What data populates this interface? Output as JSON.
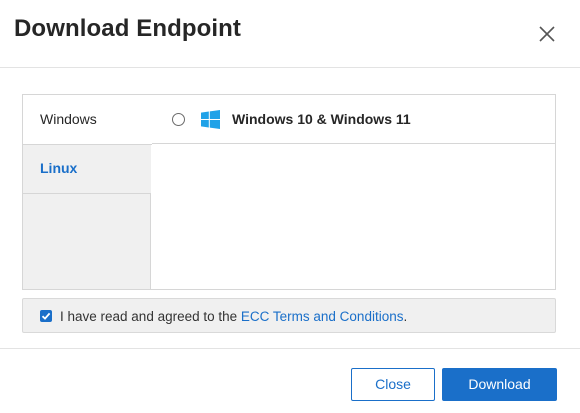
{
  "dialog": {
    "title": "Download Endpoint",
    "close_icon": "close-icon"
  },
  "tabs": [
    {
      "label": "Windows",
      "selected": true
    },
    {
      "label": "Linux",
      "selected": false
    }
  ],
  "options": [
    {
      "label": "Windows 10 & Windows 11",
      "icon": "windows-logo-icon",
      "checked": false
    }
  ],
  "agreement": {
    "checked": true,
    "text": "I have read and agreed to the ",
    "link_text": "ECC Terms and Conditions",
    "suffix": "."
  },
  "buttons": {
    "close_label": "Close",
    "download_label": "Download"
  },
  "colors": {
    "accent": "#1a6fc9",
    "windows_logo": "#1fa2e8"
  }
}
